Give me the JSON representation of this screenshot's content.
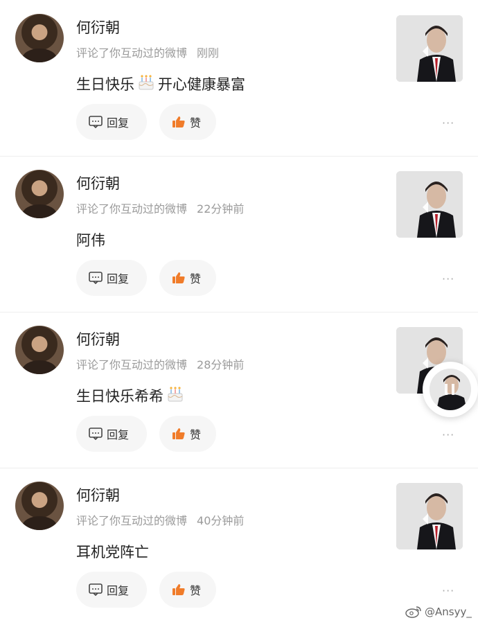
{
  "comments": [
    {
      "name": "何衍朝",
      "action": "评论了你互动过的微博",
      "time": "刚刚",
      "text": "生日快乐",
      "emoji": "cake-emoji",
      "text_after": "开心健康暴富"
    },
    {
      "name": "何衍朝",
      "action": "评论了你互动过的微博",
      "time": "22分钟前",
      "text": "阿伟",
      "emoji": "",
      "text_after": ""
    },
    {
      "name": "何衍朝",
      "action": "评论了你互动过的微博",
      "time": "28分钟前",
      "text": "生日快乐希希",
      "emoji": "cake-emoji",
      "text_after": ""
    },
    {
      "name": "何衍朝",
      "action": "评论了你互动过的微博",
      "time": "40分钟前",
      "text": "耳机党阵亡",
      "emoji": "",
      "text_after": ""
    }
  ],
  "actions": {
    "reply_label": "回复",
    "like_label": "赞",
    "more_label": "···"
  },
  "watermark": {
    "text": "@Ansyy_"
  },
  "icons": {
    "reply": "comment-icon",
    "like": "thumbs-up-icon",
    "play": "play-icon",
    "more": "more-icon"
  },
  "colors": {
    "like_accent": "#f07c2a",
    "meta_gray": "#9a9a9a",
    "pill_bg": "#f6f6f6"
  }
}
